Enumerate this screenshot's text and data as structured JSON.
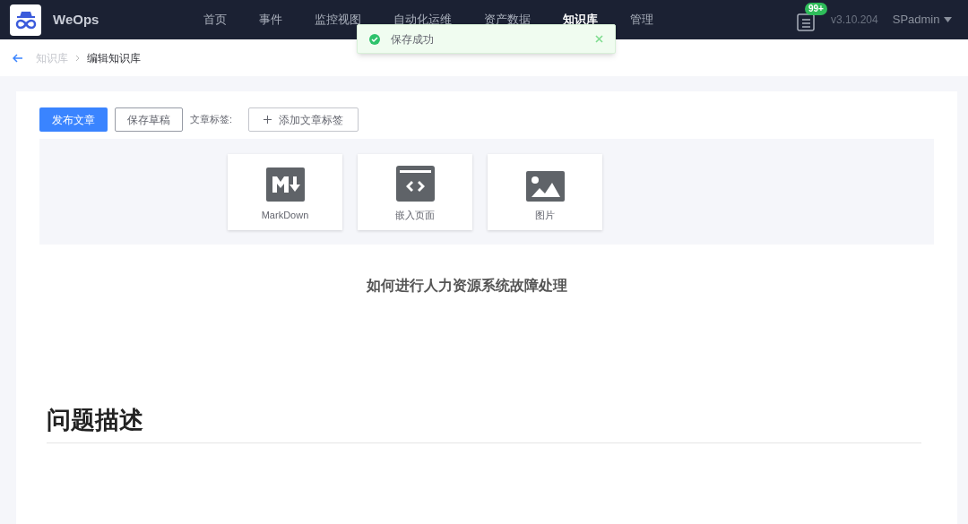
{
  "header": {
    "brand": "WeOps",
    "nav": [
      {
        "label": "首页",
        "selected": false
      },
      {
        "label": "事件",
        "selected": false
      },
      {
        "label": "监控视图",
        "selected": false
      },
      {
        "label": "自动化运维",
        "selected": false
      },
      {
        "label": "资产数据",
        "selected": false
      },
      {
        "label": "知识库",
        "selected": true
      },
      {
        "label": "管理",
        "selected": false
      }
    ],
    "notification_badge": "99+",
    "version": "v3.10.204",
    "user": "SPadmin"
  },
  "toast": {
    "message": "保存成功"
  },
  "breadcrumb": [
    "知识库",
    "编辑知识库"
  ],
  "toolbar": {
    "publish": "发布文章",
    "save_draft": "保存草稿",
    "tags_label": "文章标签:",
    "add_tag": "添加文章标签"
  },
  "insert_options": [
    {
      "kind": "markdown",
      "label": "MarkDown"
    },
    {
      "kind": "embed",
      "label": "嵌入页面"
    },
    {
      "kind": "image",
      "label": "图片"
    }
  ],
  "article": {
    "title": "如何进行人力资源系统故障处理",
    "heading": "问题描述"
  }
}
